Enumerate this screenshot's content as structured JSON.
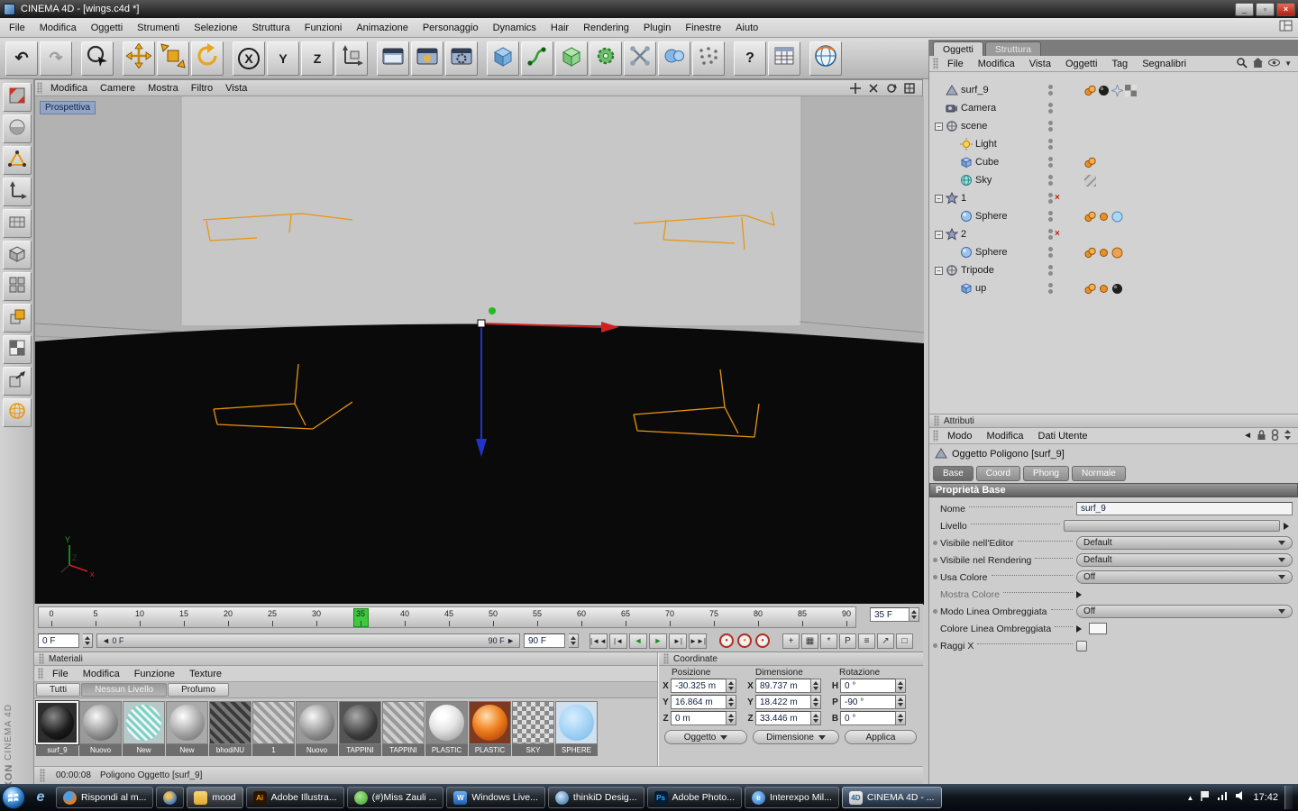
{
  "window": {
    "title": "CINEMA 4D - [wings.c4d *]"
  },
  "menubar": {
    "items": [
      "File",
      "Modifica",
      "Oggetti",
      "Strumenti",
      "Selezione",
      "Struttura",
      "Funzioni",
      "Animazione",
      "Personaggio",
      "Dynamics",
      "Hair",
      "Rendering",
      "Plugin",
      "Finestre",
      "Aiuto"
    ]
  },
  "toolbar": {
    "items": [
      {
        "icon": "undo"
      },
      {
        "icon": "redo"
      },
      {
        "sep": true
      },
      {
        "icon": "selection"
      },
      {
        "sep": true
      },
      {
        "icon": "move"
      },
      {
        "icon": "scale"
      },
      {
        "icon": "rotate"
      },
      {
        "sep": true
      },
      {
        "icon": "letter",
        "label": "X",
        "ringed": true
      },
      {
        "icon": "letter",
        "label": "Y"
      },
      {
        "icon": "letter",
        "label": "Z"
      },
      {
        "icon": "coord"
      },
      {
        "sep": true
      },
      {
        "icon": "render-view"
      },
      {
        "icon": "render-picture"
      },
      {
        "icon": "render-settings"
      },
      {
        "sep": true
      },
      {
        "icon": "cube"
      },
      {
        "icon": "spline"
      },
      {
        "icon": "nurbs"
      },
      {
        "icon": "gear"
      },
      {
        "icon": "array"
      },
      {
        "icon": "metaball"
      },
      {
        "icon": "particles"
      },
      {
        "sep": true
      },
      {
        "icon": "help"
      },
      {
        "icon": "table"
      },
      {
        "sep": true
      },
      {
        "icon": "globe"
      }
    ]
  },
  "side_toolbar": {
    "items": [
      "convert",
      "sphere-tool",
      "triangle-points",
      "axis",
      "grid-plane",
      "grid-cube",
      "panels",
      "cube-stack",
      "checkerboard",
      "box-arrow",
      "wire-sphere"
    ]
  },
  "viewport": {
    "menu": [
      "Modifica",
      "Camere",
      "Mostra",
      "Filtro",
      "Vista"
    ],
    "view_label": "Prospettiva"
  },
  "timeline": {
    "ticks": [
      "0",
      "5",
      "10",
      "15",
      "20",
      "25",
      "30",
      "35",
      "40",
      "45",
      "50",
      "55",
      "60",
      "65",
      "70",
      "75",
      "80",
      "85",
      "90"
    ],
    "current_frame": "35 F",
    "start_field": "0 F",
    "range_left": "0 F",
    "range_right": "90 F",
    "end_field": "90 F"
  },
  "materials": {
    "title": "Materiali",
    "menu": [
      "File",
      "Modifica",
      "Funzione",
      "Texture"
    ],
    "tabs": [
      "Tutti",
      "Nessun Livello",
      "Profumo"
    ],
    "items": [
      {
        "name": "surf_9",
        "look": "sphere-black",
        "selected": true
      },
      {
        "name": "Nuovo",
        "look": "sphere-gray"
      },
      {
        "name": "New",
        "look": "sphere-teal"
      },
      {
        "name": "New",
        "look": "sphere-gray2"
      },
      {
        "name": "bhodiNU",
        "look": "stripes-dark"
      },
      {
        "name": "1",
        "look": "stripes"
      },
      {
        "name": "Nuovo",
        "look": "sphere-gray"
      },
      {
        "name": "TAPPINI",
        "look": "sphere-darkgray"
      },
      {
        "name": "TAPPINI",
        "look": "stripes"
      },
      {
        "name": "PLASTIC",
        "look": "sphere-white"
      },
      {
        "name": "PLASTIC",
        "look": "sphere-orange"
      },
      {
        "name": "SKY",
        "look": "checker"
      },
      {
        "name": "SPHERE",
        "look": "sphere-blue"
      }
    ]
  },
  "status": {
    "time": "00:00:08",
    "text": "Poligono Oggetto [surf_9]"
  },
  "coordinates": {
    "title": "Coordinate",
    "columns": [
      "Posizione",
      "Dimensione",
      "Rotazione"
    ],
    "position": {
      "labels": [
        "X",
        "Y",
        "Z"
      ],
      "values": [
        "-30.325 m",
        "16.864 m",
        "0 m"
      ]
    },
    "dimension": {
      "labels": [
        "X",
        "Y",
        "Z"
      ],
      "values": [
        "89.737 m",
        "18.422 m",
        "33.446 m"
      ]
    },
    "rotation": {
      "labels": [
        "H",
        "P",
        "B"
      ],
      "values": [
        "0 °",
        "-90 °",
        "0 °"
      ]
    },
    "footer": {
      "mode": "Oggetto",
      "size": "Dimensione",
      "apply": "Applica"
    }
  },
  "objects": {
    "tabs": [
      "Oggetti",
      "Struttura"
    ],
    "menu": [
      "File",
      "Modifica",
      "Vista",
      "Oggetti",
      "Tag",
      "Segnalibri"
    ],
    "tree": [
      {
        "label": "surf_9",
        "depth": 0,
        "icon": "polygon",
        "tags": [
          "orange-pair",
          "black-sphere",
          "sparkle",
          "checker"
        ]
      },
      {
        "label": "Camera",
        "depth": 0,
        "icon": "camera",
        "tags": []
      },
      {
        "label": "scene",
        "depth": 0,
        "icon": "nullobj",
        "expand": true,
        "tags": []
      },
      {
        "label": "Light",
        "depth": 1,
        "icon": "light",
        "tags": []
      },
      {
        "label": "Cube",
        "depth": 1,
        "icon": "cube",
        "tags": [
          "orange-pair"
        ]
      },
      {
        "label": "Sky",
        "depth": 1,
        "icon": "sky",
        "tags": [
          "hatch"
        ]
      },
      {
        "label": "1",
        "depth": 0,
        "icon": "symmetry",
        "expand": true,
        "redx": true,
        "tags": []
      },
      {
        "label": "Sphere",
        "depth": 1,
        "icon": "sphere",
        "tags": [
          "orange-pair",
          "orange-dot",
          "blue-sphere"
        ]
      },
      {
        "label": "2",
        "depth": 0,
        "icon": "symmetry",
        "expand": true,
        "redx": true,
        "tags": []
      },
      {
        "label": "Sphere",
        "depth": 1,
        "icon": "sphere",
        "tags": [
          "orange-pair",
          "orange-dot",
          "orange-sphere"
        ]
      },
      {
        "label": "Tripode",
        "depth": 0,
        "icon": "nullobj",
        "expand": true,
        "tags": []
      },
      {
        "label": "up",
        "depth": 1,
        "icon": "cube",
        "tags": [
          "orange-pair",
          "orange-dot",
          "black-sphere"
        ]
      }
    ]
  },
  "attributes": {
    "title": "Attributi",
    "menu": [
      "Modo",
      "Modifica",
      "Dati Utente"
    ],
    "object_title": "Oggetto Poligono [surf_9]",
    "tabs": [
      "Base",
      "Coord",
      "Phong",
      "Normale"
    ],
    "section": "Proprietà Base",
    "rows": [
      {
        "label": "Nome",
        "control": "text",
        "value": "surf_9"
      },
      {
        "label": "Livello",
        "control": "slider",
        "endarrow": true
      },
      {
        "label": "Visibile nell'Editor",
        "control": "dropdown",
        "value": "Default",
        "dot": true
      },
      {
        "label": "Visibile nel Rendering",
        "control": "dropdown",
        "value": "Default",
        "dot": true
      },
      {
        "label": "Usa Colore",
        "control": "dropdown",
        "value": "Off",
        "dot": true
      },
      {
        "label": "Mostra Colore",
        "control": "collapsed",
        "dim": true
      },
      {
        "label": "Modo Linea Ombreggiata",
        "control": "dropdown",
        "value": "Off",
        "dot": true
      },
      {
        "label": "Colore Linea Ombreggiata",
        "control": "color"
      },
      {
        "label": "Raggi X",
        "control": "checkbox",
        "dot": true
      }
    ]
  },
  "taskbar": {
    "buttons": [
      {
        "label": "Rispondi al m...",
        "icon": "firefox"
      },
      {
        "label": "",
        "icon": "wmp"
      },
      {
        "label": "mood",
        "icon": "folder",
        "pressed": true
      },
      {
        "label": "Adobe Illustra...",
        "icon": "ai"
      },
      {
        "label": "(#)Miss  Zauli ...",
        "icon": "msn"
      },
      {
        "label": "Windows Live...",
        "icon": "wlive"
      },
      {
        "label": "thinkiD Desig...",
        "icon": "globe"
      },
      {
        "label": "Adobe Photo...",
        "icon": "ps"
      },
      {
        "label": "Interexpo Mil...",
        "icon": "ie"
      },
      {
        "label": "CINEMA 4D - ...",
        "icon": "c4d",
        "active": true
      }
    ],
    "time": "17:42"
  },
  "branding": {
    "line1": "MAXON",
    "line2": "CINEMA 4D"
  }
}
